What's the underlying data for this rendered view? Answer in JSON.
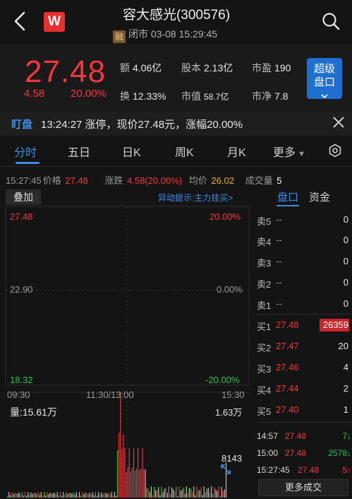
{
  "header": {
    "logo_text": "W",
    "title": "容大感光(300576)",
    "rong_badge": "融",
    "status": "闭市 03-08 15:29:45"
  },
  "quote": {
    "price": "27.48",
    "change": "4.58",
    "change_pct": "20.00%",
    "stats": {
      "turnover_amount_label": "额",
      "turnover_amount": "4.06亿",
      "share_capital_label": "股本",
      "share_capital": "2.13亿",
      "pe_label": "市盈",
      "pe": "190",
      "turnover_rate_label": "换",
      "turnover_rate": "12.33%",
      "market_cap_label": "市值",
      "market_cap": "58.7亿",
      "pb_label": "市净",
      "pb": "7.8"
    },
    "pankou_button": [
      "超级",
      "盘口"
    ]
  },
  "alert": {
    "tag": "盯盘",
    "text": "13:24:27 涨停，现价27.48元，涨幅20.00%"
  },
  "tabs": [
    "分时",
    "五日",
    "日K",
    "周K",
    "月K",
    "更多"
  ],
  "info_row": {
    "time": "15:27:45",
    "price_label": "价格",
    "price": "27.48",
    "change_label": "涨跌",
    "change": "4.58(20.00%)",
    "avg_label": "均价",
    "avg": "26.02",
    "volume_label": "成交量",
    "volume": "5"
  },
  "chart": {
    "overlay_button": "叠加",
    "anomaly_hint": "异动提示:主力挂买>",
    "price_high": "27.48",
    "pct_high": "20.00%",
    "price_mid": "22.90",
    "pct_mid": "0.00%",
    "price_low": "18.32",
    "pct_low": "-20.00%",
    "time_labels": [
      "09:30",
      "11:30/13:00",
      "15:30"
    ],
    "volume_label": "量:15.61万",
    "volume_max": "1.63万",
    "volume_last": "8143",
    "colors": {
      "price_line": "#ffffff",
      "avg_line": "#e6b422",
      "up": "#f0383e",
      "down": "#27c24c"
    }
  },
  "chart_data": {
    "type": "line",
    "x": [
      "09:30",
      "11:30/13:00",
      "15:30"
    ],
    "series": [
      {
        "values": [
          22.9,
          23.0,
          22.98,
          23.0,
          22.95,
          23.0,
          25.6,
          26.4,
          27.0,
          27.48,
          27.48
        ]
      },
      {
        "values": [
          22.9,
          22.95,
          22.97,
          22.98,
          22.97,
          22.98,
          24.4,
          25.3,
          25.8,
          26.0,
          26.02
        ]
      }
    ],
    "ylim": [
      18.32,
      27.48
    ]
  },
  "orderbook": {
    "tabs": [
      "盘口",
      "资金"
    ],
    "asks": [
      {
        "label": "卖5",
        "price": "--",
        "vol": "0"
      },
      {
        "label": "卖4",
        "price": "--",
        "vol": "0"
      },
      {
        "label": "卖3",
        "price": "--",
        "vol": "0"
      },
      {
        "label": "卖2",
        "price": "--",
        "vol": "0"
      },
      {
        "label": "卖1",
        "price": "--",
        "vol": "0"
      }
    ],
    "bids": [
      {
        "label": "买1",
        "price": "27.48",
        "vol": "26359"
      },
      {
        "label": "买2",
        "price": "27.47",
        "vol": "20"
      },
      {
        "label": "买3",
        "price": "27.46",
        "vol": "4"
      },
      {
        "label": "买4",
        "price": "27.44",
        "vol": "2"
      },
      {
        "label": "买5",
        "price": "27.40",
        "vol": "1"
      }
    ],
    "trades": [
      {
        "time": "14:57",
        "price": "27.48",
        "vol": "7↓"
      },
      {
        "time": "15:00",
        "price": "27.48",
        "vol": "2578↓"
      },
      {
        "time": "15:27:45",
        "price": "27.48",
        "vol": "5↑"
      }
    ],
    "more_trades": "更多成交"
  }
}
